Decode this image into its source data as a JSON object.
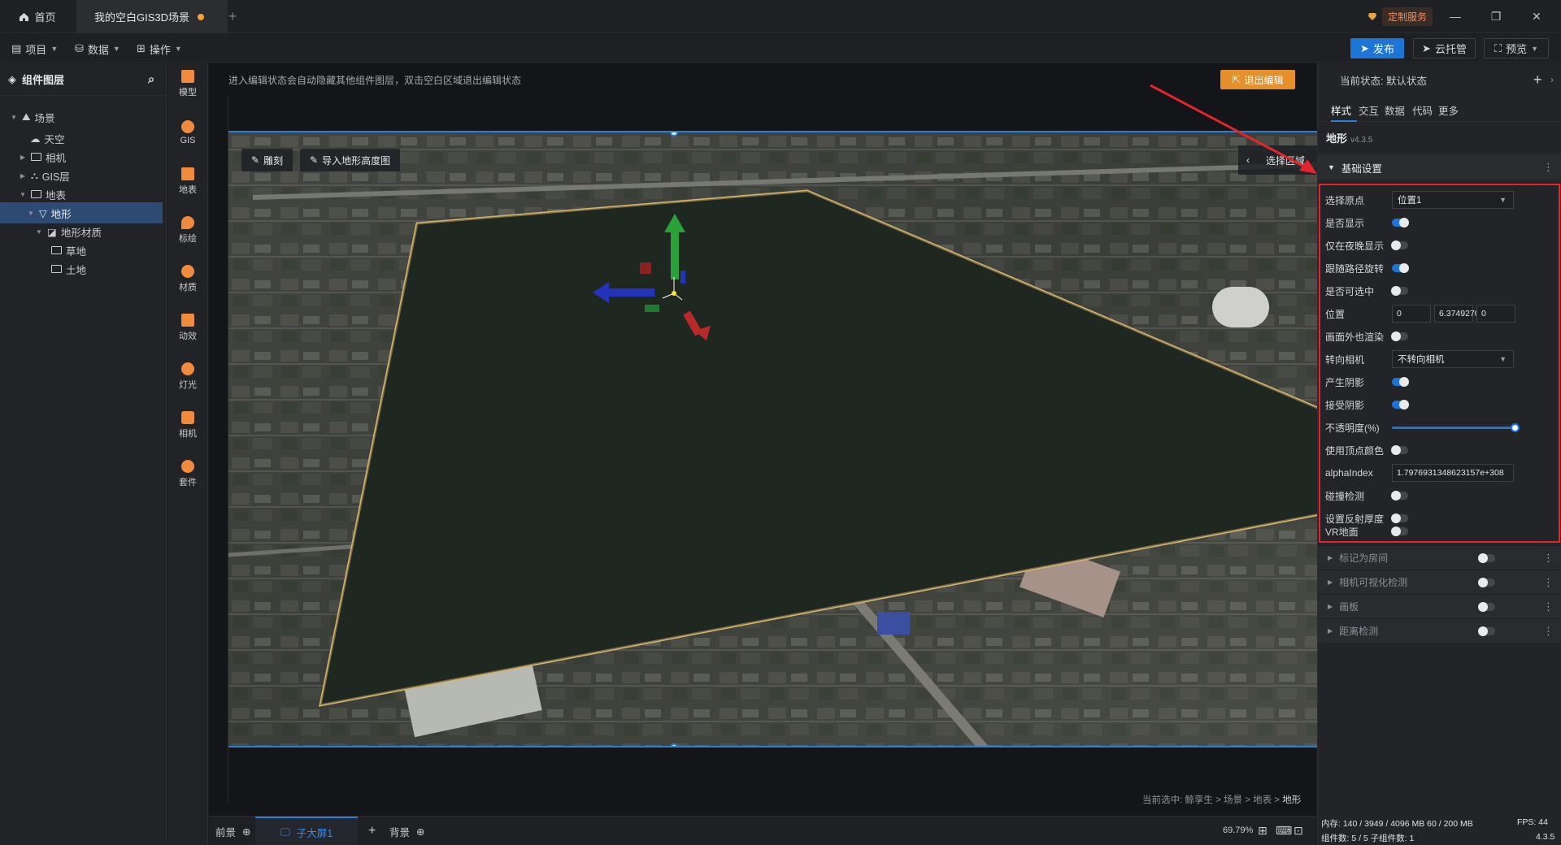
{
  "tabs": {
    "home": "首页",
    "scene": "我的空白GIS3D场景",
    "add": "+"
  },
  "header": {
    "custom_service": "定制服务"
  },
  "menu": {
    "project": "项目",
    "data": "数据",
    "operation": "操作",
    "publish": "发布",
    "cloud": "云托管",
    "preview": "预览"
  },
  "layers": {
    "title": "组件图层",
    "items": [
      {
        "label": "场景"
      },
      {
        "label": "天空"
      },
      {
        "label": "相机"
      },
      {
        "label": "GIS层"
      },
      {
        "label": "地表"
      },
      {
        "label": "地形"
      },
      {
        "label": "地形材质"
      },
      {
        "label": "草地"
      },
      {
        "label": "土地"
      }
    ]
  },
  "tools": [
    "模型",
    "GIS",
    "地表",
    "标绘",
    "材质",
    "动效",
    "灯光",
    "相机",
    "套件"
  ],
  "viewport": {
    "hint": "进入编辑状态会自动隐藏其他组件图层，双击空白区域退出编辑状态",
    "exit_edit": "退出编辑",
    "sculpt": "雕刻",
    "import_height": "导入地形高度图",
    "select_area": "选择区域",
    "breadcrumb_prefix": "当前选中: 鲸孪生 > 场景 > 地表 >",
    "breadcrumb_current": "地形"
  },
  "bottom": {
    "foreground": "前景",
    "sub_screen": "子大屏1",
    "background": "背景",
    "zoom": "69.79%"
  },
  "panel": {
    "current_state": "当前状态:  默认状态",
    "tabs": [
      "样式",
      "交互",
      "数据",
      "代码",
      "更多"
    ],
    "component": "地形",
    "version": "v4.3.5",
    "basic_settings": "基础设置",
    "props": {
      "origin_label": "选择原点",
      "origin_value": "位置1",
      "visible_label": "是否显示",
      "night_label": "仅在夜晚显示",
      "follow_label": "跟随路径旋转",
      "selectable_label": "是否可选中",
      "position_label": "位置",
      "pos_x": "0",
      "pos_y": "6.3749270",
      "pos_z": "0",
      "offscreen_label": "画面外也渲染",
      "face_camera_label": "转向相机",
      "face_camera_value": "不转向相机",
      "cast_shadow_label": "产生阴影",
      "receive_shadow_label": "接受阴影",
      "opacity_label": "不透明度(%)",
      "opacity_value": 100,
      "vertex_color_label": "使用顶点颜色",
      "alpha_label": "alphaIndex",
      "alpha_value": "1.7976931348623157e+308",
      "collision_label": "碰撞检测",
      "reflect_label": "设置反射厚度",
      "vr_label": "VR地面"
    },
    "toggles": {
      "visible": true,
      "night": false,
      "follow": true,
      "selectable": false,
      "offscreen": false,
      "cast_shadow": true,
      "receive_shadow": true,
      "vertex_color": false,
      "collision": false,
      "reflect": false,
      "vr": false
    },
    "collapsed_sections": [
      "标记为房间",
      "相机可视化检测",
      "画板",
      "距离检测"
    ]
  },
  "status": {
    "memory": "内存:  140 / 3949 / 4096 MB  60 / 200 MB",
    "fps": "FPS:  44",
    "components": "组件数: 5 / 5   子组件数: 1",
    "version": "4.3.5"
  }
}
